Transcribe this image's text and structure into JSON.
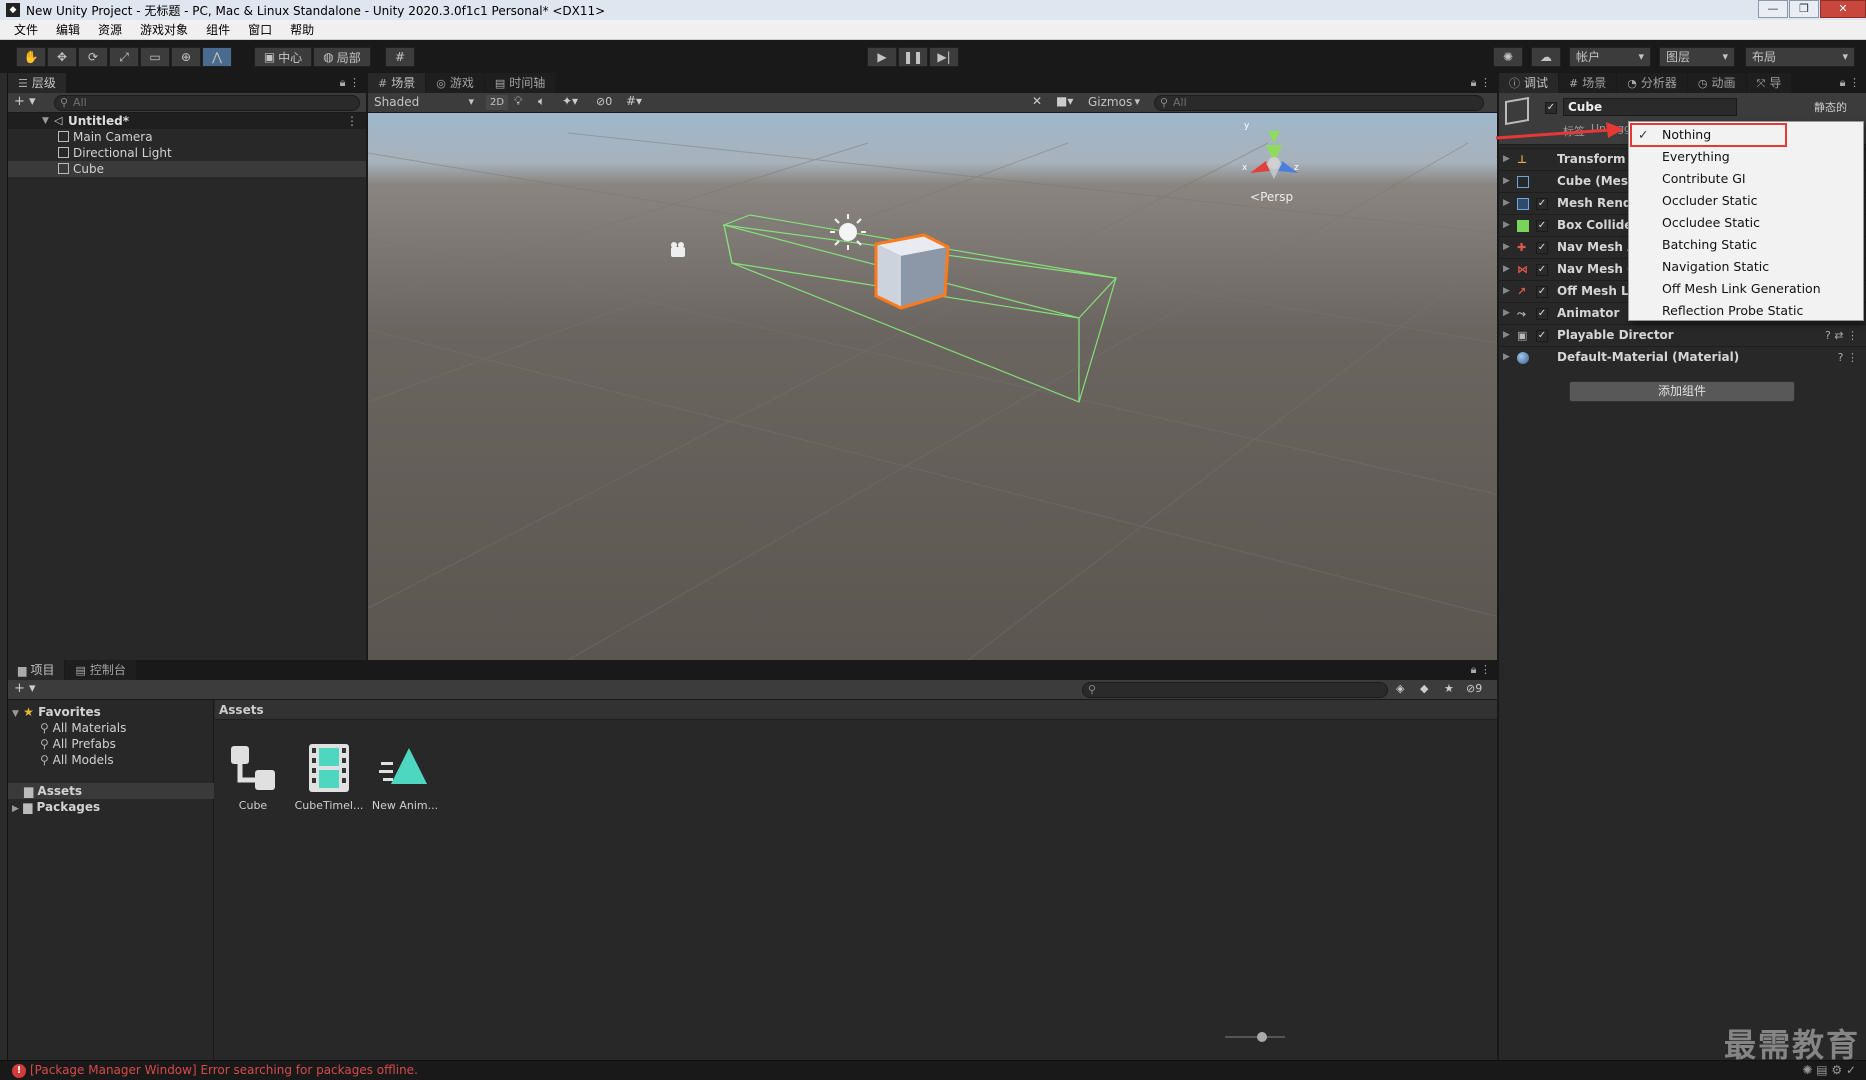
{
  "window": {
    "title": "New Unity Project - 无标题 - PC, Mac & Linux Standalone - Unity 2020.3.0f1c1 Personal* <DX11>",
    "minimize": "—",
    "maximize": "❐",
    "close": "✕"
  },
  "menubar": [
    "文件",
    "编辑",
    "资源",
    "游戏对象",
    "组件",
    "窗口",
    "帮助"
  ],
  "toolbar": {
    "pivot_label": "中心",
    "local_label": "局部",
    "account_label": "帐户",
    "layers_label": "图层",
    "layout_label": "布局"
  },
  "hierarchy": {
    "tab": "层级",
    "search_placeholder": "All",
    "scene_name": "Untitled*",
    "objects": [
      "Main Camera",
      "Directional Light",
      "Cube"
    ]
  },
  "scene": {
    "tabs": [
      "场景",
      "游戏",
      "时间轴"
    ],
    "shading_mode": "Shaded",
    "toggle_2d": "2D",
    "hidden_count": "0",
    "gizmos_label": "Gizmos",
    "search_placeholder": "All",
    "projection_label": "Persp"
  },
  "inspector": {
    "tabs": [
      "调试",
      "场景",
      "分析器",
      "动画"
    ],
    "tab_more": "导",
    "object_name": "Cube",
    "static_label": "静态的",
    "tag_label": "标签",
    "tag_value": "Untagged",
    "components": [
      {
        "name": "Transform",
        "icon": "transform-icon",
        "checkbox": false
      },
      {
        "name": "Cube (Mesh Filter)",
        "icon": "mesh-filter-icon",
        "checkbox": false
      },
      {
        "name": "Mesh Renderer",
        "icon": "mesh-renderer-icon",
        "checkbox": true
      },
      {
        "name": "Box Collider",
        "icon": "box-collider-icon",
        "checkbox": true
      },
      {
        "name": "Nav Mesh Agent",
        "icon": "nav-mesh-agent-icon",
        "checkbox": true
      },
      {
        "name": "Nav Mesh Obstacle",
        "icon": "nav-mesh-obstacle-icon",
        "checkbox": true
      },
      {
        "name": "Off Mesh Link",
        "icon": "off-mesh-link-icon",
        "checkbox": true
      },
      {
        "name": "Animator",
        "icon": "animator-icon",
        "checkbox": true
      },
      {
        "name": "Playable Director",
        "icon": "playable-director-icon",
        "checkbox": true
      },
      {
        "name": "Default-Material (Material)",
        "icon": "material-icon",
        "checkbox": false
      }
    ],
    "add_component": "添加组件"
  },
  "static_menu": {
    "items": [
      "Nothing",
      "Everything",
      "Contribute GI",
      "Occluder Static",
      "Occludee Static",
      "Batching Static",
      "Navigation Static",
      "Off Mesh Link Generation",
      "Reflection Probe Static"
    ],
    "checked": "Nothing",
    "check_glyph": "✓",
    "highlight_color": "#e53935"
  },
  "project": {
    "tabs": [
      "项目",
      "控制台"
    ],
    "favorites_label": "Favorites",
    "favorites": [
      "All Materials",
      "All Prefabs",
      "All Models"
    ],
    "roots": [
      "Assets",
      "Packages"
    ],
    "breadcrumb": "Assets",
    "hidden_count": "9",
    "assets": [
      {
        "label": "Cube",
        "icon": "prefab-icon"
      },
      {
        "label": "CubeTimel...",
        "icon": "timeline-icon"
      },
      {
        "label": "New Anim...",
        "icon": "animation-clip-icon"
      }
    ]
  },
  "status": {
    "error_glyph": "!",
    "message": "[Package Manager Window] Error searching for packages offline."
  },
  "watermark": "最需教育",
  "colors": {
    "selection_orange": "#ff7a1a",
    "collider_green": "#86e07a",
    "error_red": "#d84a4a"
  }
}
